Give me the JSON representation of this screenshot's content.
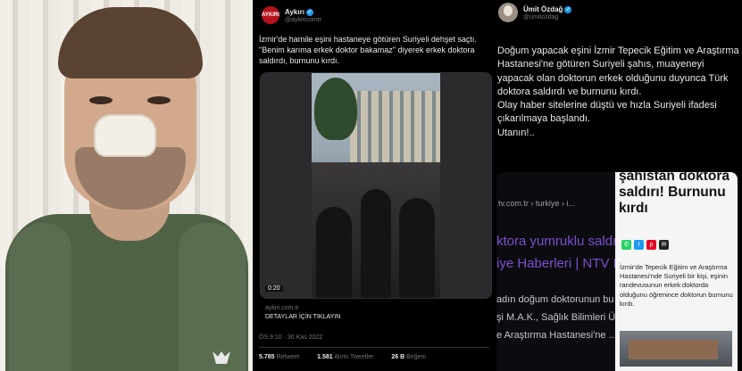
{
  "left_photo": {
    "description_icon": "man-with-nose-bandage-photo"
  },
  "middle_tweet": {
    "avatar_text": "AYKIRI",
    "author_name": "Aykırı",
    "handle": "@aykiricomtr",
    "verified_icon": "verified-badge-icon",
    "text": "İzmir'de hamile eşini hastaneye götüren Suriyeli dehşet saçtı. \"Benim karıma erkek doktor bakamaz\" diyerek erkek doktora saldırdı, burnunu kırdı.",
    "video_duration": "0:20",
    "link_domain": "aykiri.com.tr",
    "link_title": "DETAYLAR İÇİN TIKLAYIN",
    "timestamp": "ÖS 9:10 · 30 Kas 2022",
    "stats": [
      {
        "count": "5.785",
        "label": "Retweet"
      },
      {
        "count": "1.581",
        "label": "Alıntı Tweetler"
      },
      {
        "count": "26 B",
        "label": "Beğeni"
      }
    ]
  },
  "right_tweet": {
    "author_name": "Ümit Özdağ",
    "handle": "@umitozdag",
    "verified_icon": "verified-badge-icon",
    "text": "Doğum yapacak eşini İzmir Tepecik Eğitim ve Araştırma\nHastanesi'ne götüren Suriyeli şahıs, muayeneyi\nyapacak olan doktorun erkek olduğunu duyunca Türk\ndoktora saldırdı ve burnunu kırdı.\nOlay haber sitelerine düştü ve hızla Suriyeli ifadesi\nçıkarılmaya başlandı.\nUtanın!..",
    "card_left": {
      "breadcrumb": "tv.com.tr › turkiye › i...",
      "headline_1": "ktora yumruklu saldı",
      "headline_2": "iye Haberleri | NTV H",
      "snippet_1": "adın doğum doktorunun bu",
      "snippet_2": "şi M.A.K., Sağlık Bilimleri Ün",
      "snippet_3": "e Araştırma Hastanesi'ne ..."
    },
    "card_right": {
      "title": "şahıstan doktora saldırı! Burnunu kırdı",
      "body": "İzmir'de Tepecik Eğitim ve Araştırma Hastanesi'nde Suriyeli bir kişi, eşinin randevusunun erkek doktorda olduğunu öğrenince doktorun burnunu kırdı.",
      "share_icons": [
        "whatsapp-icon",
        "twitter-icon",
        "pinterest-icon",
        "email-icon"
      ]
    }
  },
  "colors": {
    "background": "#000000",
    "text": "#e7e9ea",
    "muted": "#71767b",
    "verified": "#1d9bf0",
    "headline_purple": "#7b4fd0"
  }
}
